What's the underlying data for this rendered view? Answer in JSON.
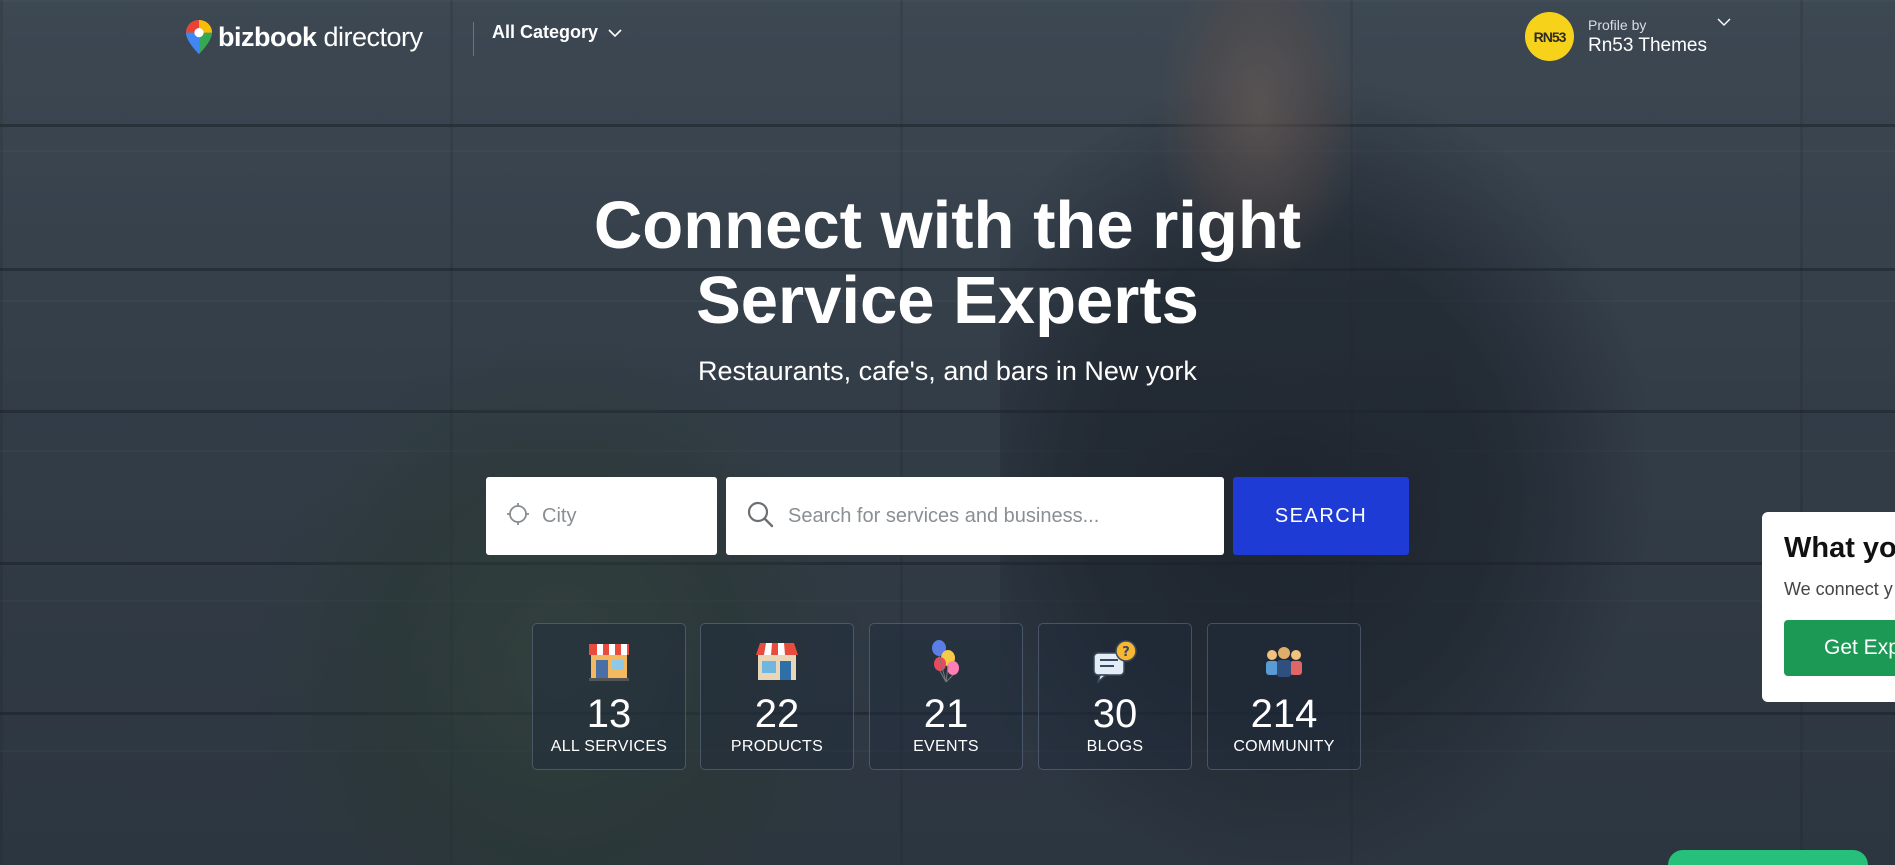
{
  "header": {
    "logo_bold": "bizbook",
    "logo_light": "directory",
    "category_label": "All Category",
    "profile": {
      "avatar_text": "RN53",
      "small_label": "Profile by",
      "name": "Rn53 Themes"
    }
  },
  "hero": {
    "title_line1": "Connect with the right",
    "title_line2": "Service Experts",
    "subtitle": "Restaurants, cafe's, and bars in New york"
  },
  "search": {
    "city_placeholder": "City",
    "query_placeholder": "Search for services and business...",
    "button_label": "SEARCH"
  },
  "stats": [
    {
      "value": "13",
      "label": "ALL SERVICES",
      "icon": "shop-icon"
    },
    {
      "value": "22",
      "label": "PRODUCTS",
      "icon": "store-icon"
    },
    {
      "value": "21",
      "label": "EVENTS",
      "icon": "balloons-icon"
    },
    {
      "value": "30",
      "label": "BLOGS",
      "icon": "chat-question-icon"
    },
    {
      "value": "214",
      "label": "COMMUNITY",
      "icon": "people-icon"
    }
  ],
  "promo": {
    "title": "What yo",
    "text": "We connect y",
    "button_label": "Get Exp"
  },
  "colors": {
    "search_button": "#1f3bd6",
    "promo_button": "#1c9a55",
    "avatar": "#f7d21a"
  }
}
